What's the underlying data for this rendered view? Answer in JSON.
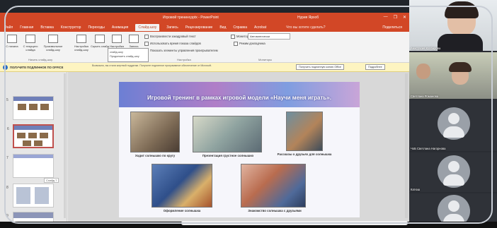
{
  "window": {
    "title": "Игровой тренинг.pptx - PowerPoint",
    "user": "Нурия Ярхоб",
    "controls": [
      "—",
      "❐",
      "✕"
    ]
  },
  "tabs": {
    "items": [
      "Файл",
      "Главная",
      "Вставка",
      "Конструктор",
      "Переходы",
      "Анимация",
      "Слайд-шоу",
      "Запись",
      "Рецензирование",
      "Вид",
      "Справка",
      "Acrobat"
    ],
    "active_index": 6,
    "search": "Что вы хотите сделать?",
    "share": "Поделиться"
  },
  "ribbon": {
    "buttons": [
      "С начала",
      "С текущего слайда",
      "Произвольное слайд-шоу",
      "Настройка слайд-шоу",
      "Скрыть слайд",
      "Настройка времени",
      "Запись слайд-шоу"
    ],
    "checks": [
      "Воспроизвести закадровый текст",
      "Использовать время показа слайдов",
      "Показать элементы управления проигрывателем"
    ],
    "monitor_label": "Монитор:",
    "monitor_value": "Автоматически",
    "presenter_view": "Режим докладчика",
    "group_start": "Начать слайд-шоу",
    "group_setup": "Настройка",
    "group_monitors": "Мониторы",
    "popup_lines": [
      "слайд-шоу",
      "Продолжить слайд-шоу"
    ]
  },
  "infobar": {
    "icon": "i",
    "heading": "ПОЛУЧИТЕ ПОДЛИННОЕ ПО OFFICE",
    "message": "Возможно, вы стали жертвой подделки. Получите подлинное программное обеспечение от Microsoft.",
    "button_learn": "Получить подлинную копию Office",
    "button_more": "Подробнее"
  },
  "thumbnails": {
    "numbers": [
      "5",
      "6",
      "7",
      "8",
      "9"
    ],
    "selected_index": 1,
    "tooltip": "Слайд 7"
  },
  "slide": {
    "title": "Игровой тренинг в рамках игровой модели «Научи меня играть».",
    "captions": [
      "Ходит солнышко по кругу",
      "Презентация грустное солнышко",
      "Рассказы о друзьях для солнышка",
      "Оформление солнышка",
      "Знакомство солнышка с друзьями"
    ]
  },
  "participants": [
    {
      "name": "Анастасия Кулбарова",
      "camera": true
    },
    {
      "name": "Светлана Романова",
      "camera": true
    },
    {
      "name": "ЧоБ Светлана Нагорнова",
      "camera": false
    },
    {
      "name": "Катюш",
      "camera": false
    },
    {
      "name": "",
      "camera": false
    }
  ],
  "colors": {
    "accent": "#d24726",
    "infobar": "#fdf4c1",
    "selected_thumb": "#c0504d"
  }
}
